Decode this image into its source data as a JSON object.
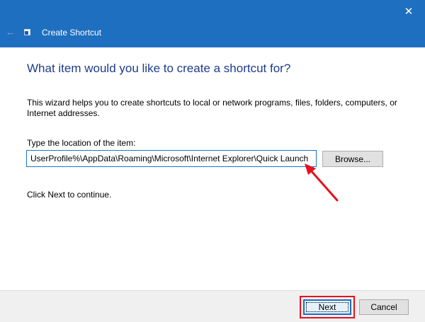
{
  "window": {
    "title": "Create Shortcut",
    "close_glyph": "✕",
    "back_glyph": "←"
  },
  "wizard": {
    "heading": "What item would you like to create a shortcut for?",
    "description": "This wizard helps you to create shortcuts to local or network programs, files, folders, computers, or Internet addresses.",
    "location_label": "Type the location of the item:",
    "location_value": "UserProfile%\\AppData\\Roaming\\Microsoft\\Internet Explorer\\Quick Launch",
    "browse_label": "Browse...",
    "continue_text": "Click Next to continue."
  },
  "footer": {
    "next_label": "Next",
    "cancel_label": "Cancel"
  },
  "colors": {
    "titlebar": "#1f6fc0",
    "heading": "#1d3c8c",
    "annotation": "#e8101d"
  }
}
